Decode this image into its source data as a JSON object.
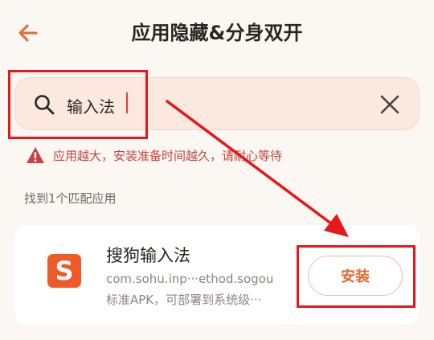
{
  "header": {
    "title": "应用隐藏&分身双开",
    "back_icon": "arrow-left-icon"
  },
  "search": {
    "value": "输入法",
    "search_icon": "search-icon",
    "clear_icon": "close-icon"
  },
  "warning": {
    "text": "应用越大，安装准备时间越久，请耐心等待",
    "icon": "warning-icon"
  },
  "results": {
    "summary": "找到1个匹配应用",
    "apps": [
      {
        "name": "搜狗输入法",
        "package": "com.sohu.inp···ethod.sogou",
        "description": "标准APK，可部署到系统级···",
        "icon_letter": "S",
        "install_label": "安装"
      }
    ]
  },
  "colors": {
    "accent": "#e26a34",
    "annotation": "#e5171c",
    "warning": "#c74440",
    "search_bg": "#fbe9e0"
  }
}
